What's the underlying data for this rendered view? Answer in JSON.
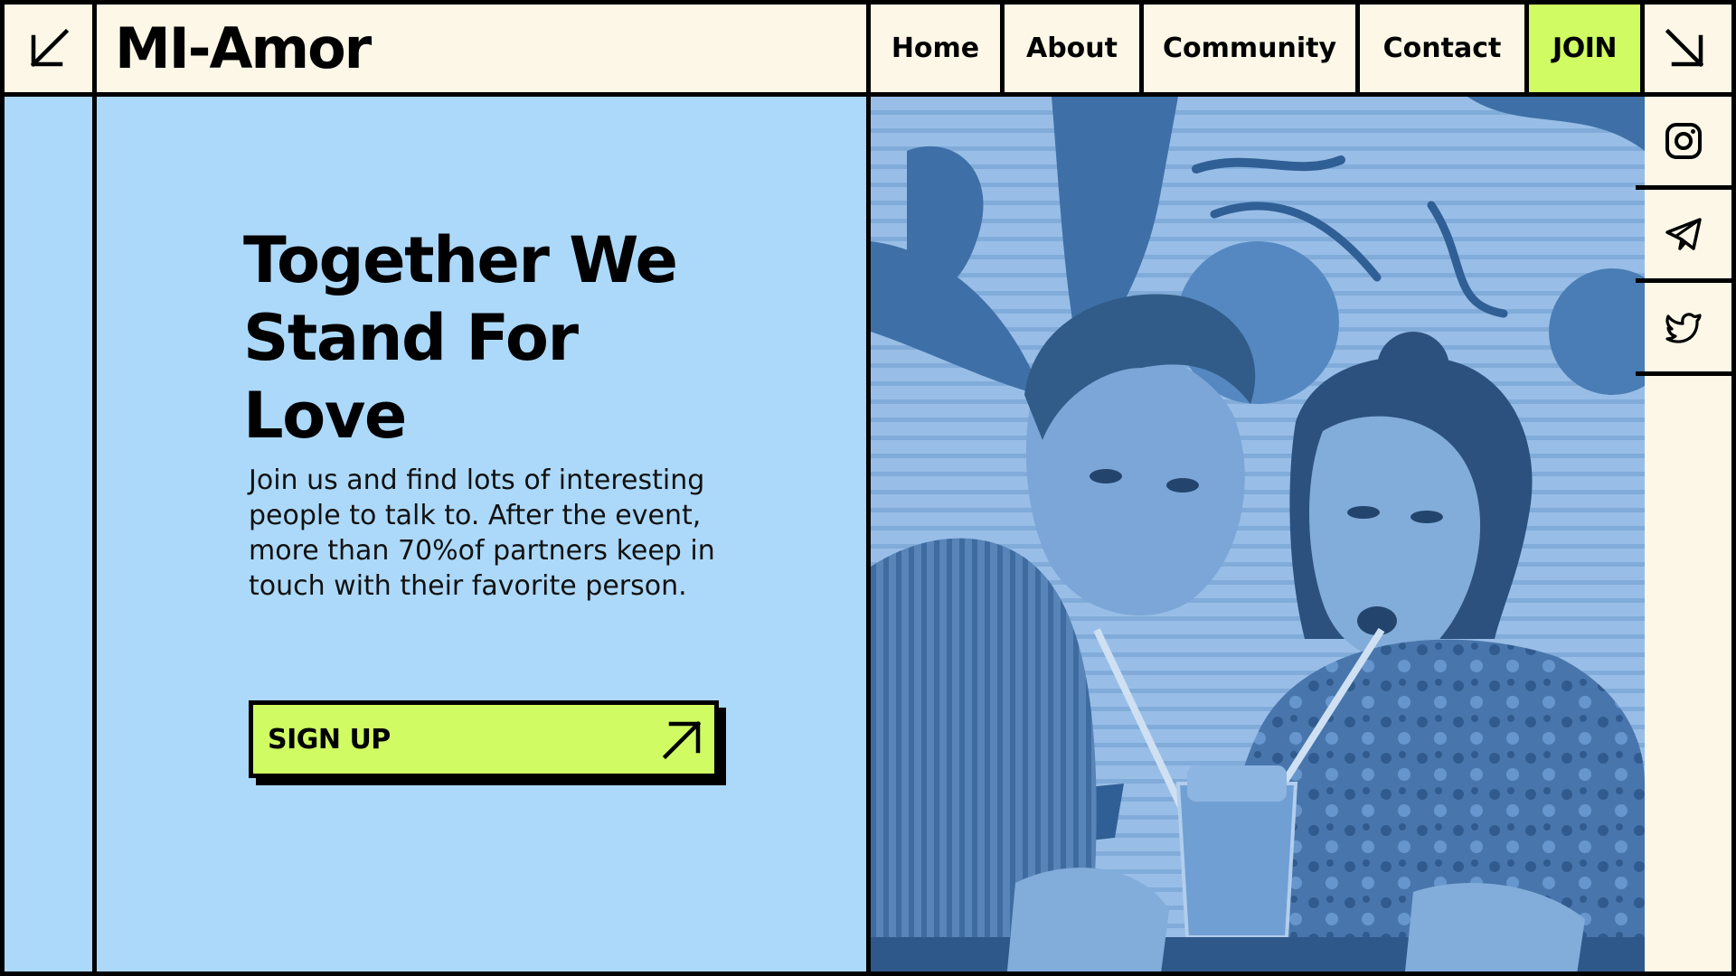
{
  "brand": {
    "name": "MI-Amor"
  },
  "nav": {
    "items": [
      {
        "label": "Home"
      },
      {
        "label": "About"
      },
      {
        "label": "Community"
      },
      {
        "label": "Contact"
      }
    ],
    "join_label": "JOIN"
  },
  "hero": {
    "title": "Together We Stand For Love",
    "description": "Join us and find lots of interesting people to talk to. After the event, more than 70%of partners keep in touch with their favorite person.",
    "cta_label": "SIGN UP"
  },
  "social": {
    "icons": [
      "instagram-icon",
      "telegram-icon",
      "twitter-icon"
    ]
  },
  "colors": {
    "cream": "#fcf7e7",
    "sky_blue": "#acd9fa",
    "lime": "#d0fb62",
    "ink": "#000000",
    "photo_tint": "#5f8ec2"
  }
}
